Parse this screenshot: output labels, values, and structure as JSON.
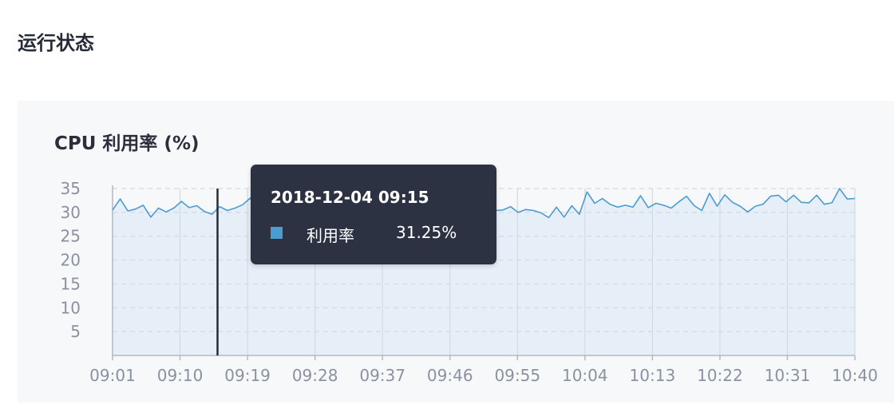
{
  "page": {
    "section_title": "运行状态"
  },
  "card": {
    "title": "CPU 利用率 (%)"
  },
  "colors": {
    "line": "#4c9bd1",
    "area": "#e6eff8",
    "grid": "#d4d9df",
    "cursor": "#262b38",
    "tooltip_bg": "#2d3243"
  },
  "tooltip": {
    "time": "2018-12-04 09:15",
    "series_label": "利用率",
    "value": "31.25%"
  },
  "chart_data": {
    "type": "area",
    "title": "CPU 利用率 (%)",
    "xlabel": "",
    "ylabel": "",
    "ylim": [
      0,
      35
    ],
    "yticks": [
      5,
      10,
      15,
      20,
      25,
      30,
      35
    ],
    "x_tick_labels": [
      "09:01",
      "09:10",
      "09:19",
      "09:28",
      "09:37",
      "09:46",
      "09:55",
      "10:04",
      "10:13",
      "10:22",
      "10:31",
      "10:40"
    ],
    "x_start": "09:01",
    "x_end": "10:40",
    "cursor_x": "09:15",
    "series": [
      {
        "values": [
          30.5,
          32.8,
          30.3,
          30.7,
          31.5,
          29.0,
          30.9,
          30.1,
          30.9,
          32.3,
          31.0,
          31.4,
          30.2,
          29.6,
          31.2,
          30.4,
          30.9,
          31.6,
          33.0,
          30.1,
          31.3,
          30.9,
          30.2,
          31.1,
          29.8,
          30.7,
          30.2,
          29.6,
          30.5,
          29.9,
          30.3,
          29.3,
          30.1,
          30.6,
          30.0,
          29.2,
          30.7,
          29.8,
          30.3,
          29.6,
          30.3,
          29.9,
          30.2,
          29.4,
          30.4,
          29.8,
          30.1,
          29.6,
          30.3,
          28.8,
          30.4,
          30.5,
          31.2,
          30.0,
          30.6,
          30.4,
          29.9,
          28.9,
          31.1,
          29.0,
          31.4,
          29.6,
          34.3,
          31.9,
          32.9,
          31.7,
          31.1,
          31.5,
          31.1,
          33.5,
          31.0,
          31.9,
          31.5,
          30.9,
          32.2,
          33.4,
          31.4,
          30.4,
          34.0,
          31.3,
          33.7,
          32.1,
          31.3,
          30.1,
          31.3,
          31.7,
          33.4,
          33.6,
          32.2,
          33.6,
          32.1,
          32.0,
          33.6,
          31.7,
          32.0,
          35.0,
          32.8,
          32.9
        ]
      }
    ]
  }
}
